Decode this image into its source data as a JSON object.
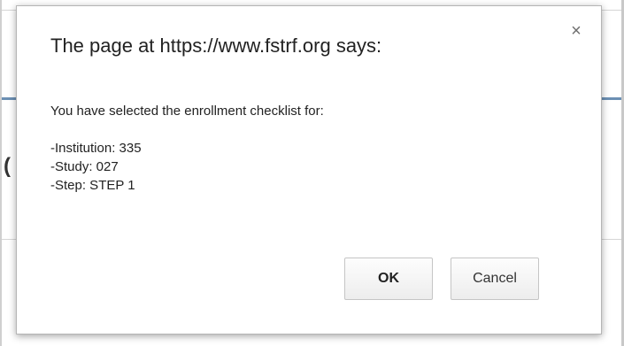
{
  "dialog": {
    "title": "The page at https://www.fstrf.org says:",
    "close_symbol": "×",
    "message_intro": "You have selected the enrollment checklist for:",
    "details": {
      "institution": "-Institution: 335",
      "study": "-Study: 027",
      "step": "-Step: STEP 1"
    },
    "buttons": {
      "ok_label": "OK",
      "cancel_label": "Cancel"
    }
  },
  "background": {
    "partial_glyph": "("
  },
  "colors": {
    "accent_line": "#6b8fb3",
    "text": "#222222"
  }
}
